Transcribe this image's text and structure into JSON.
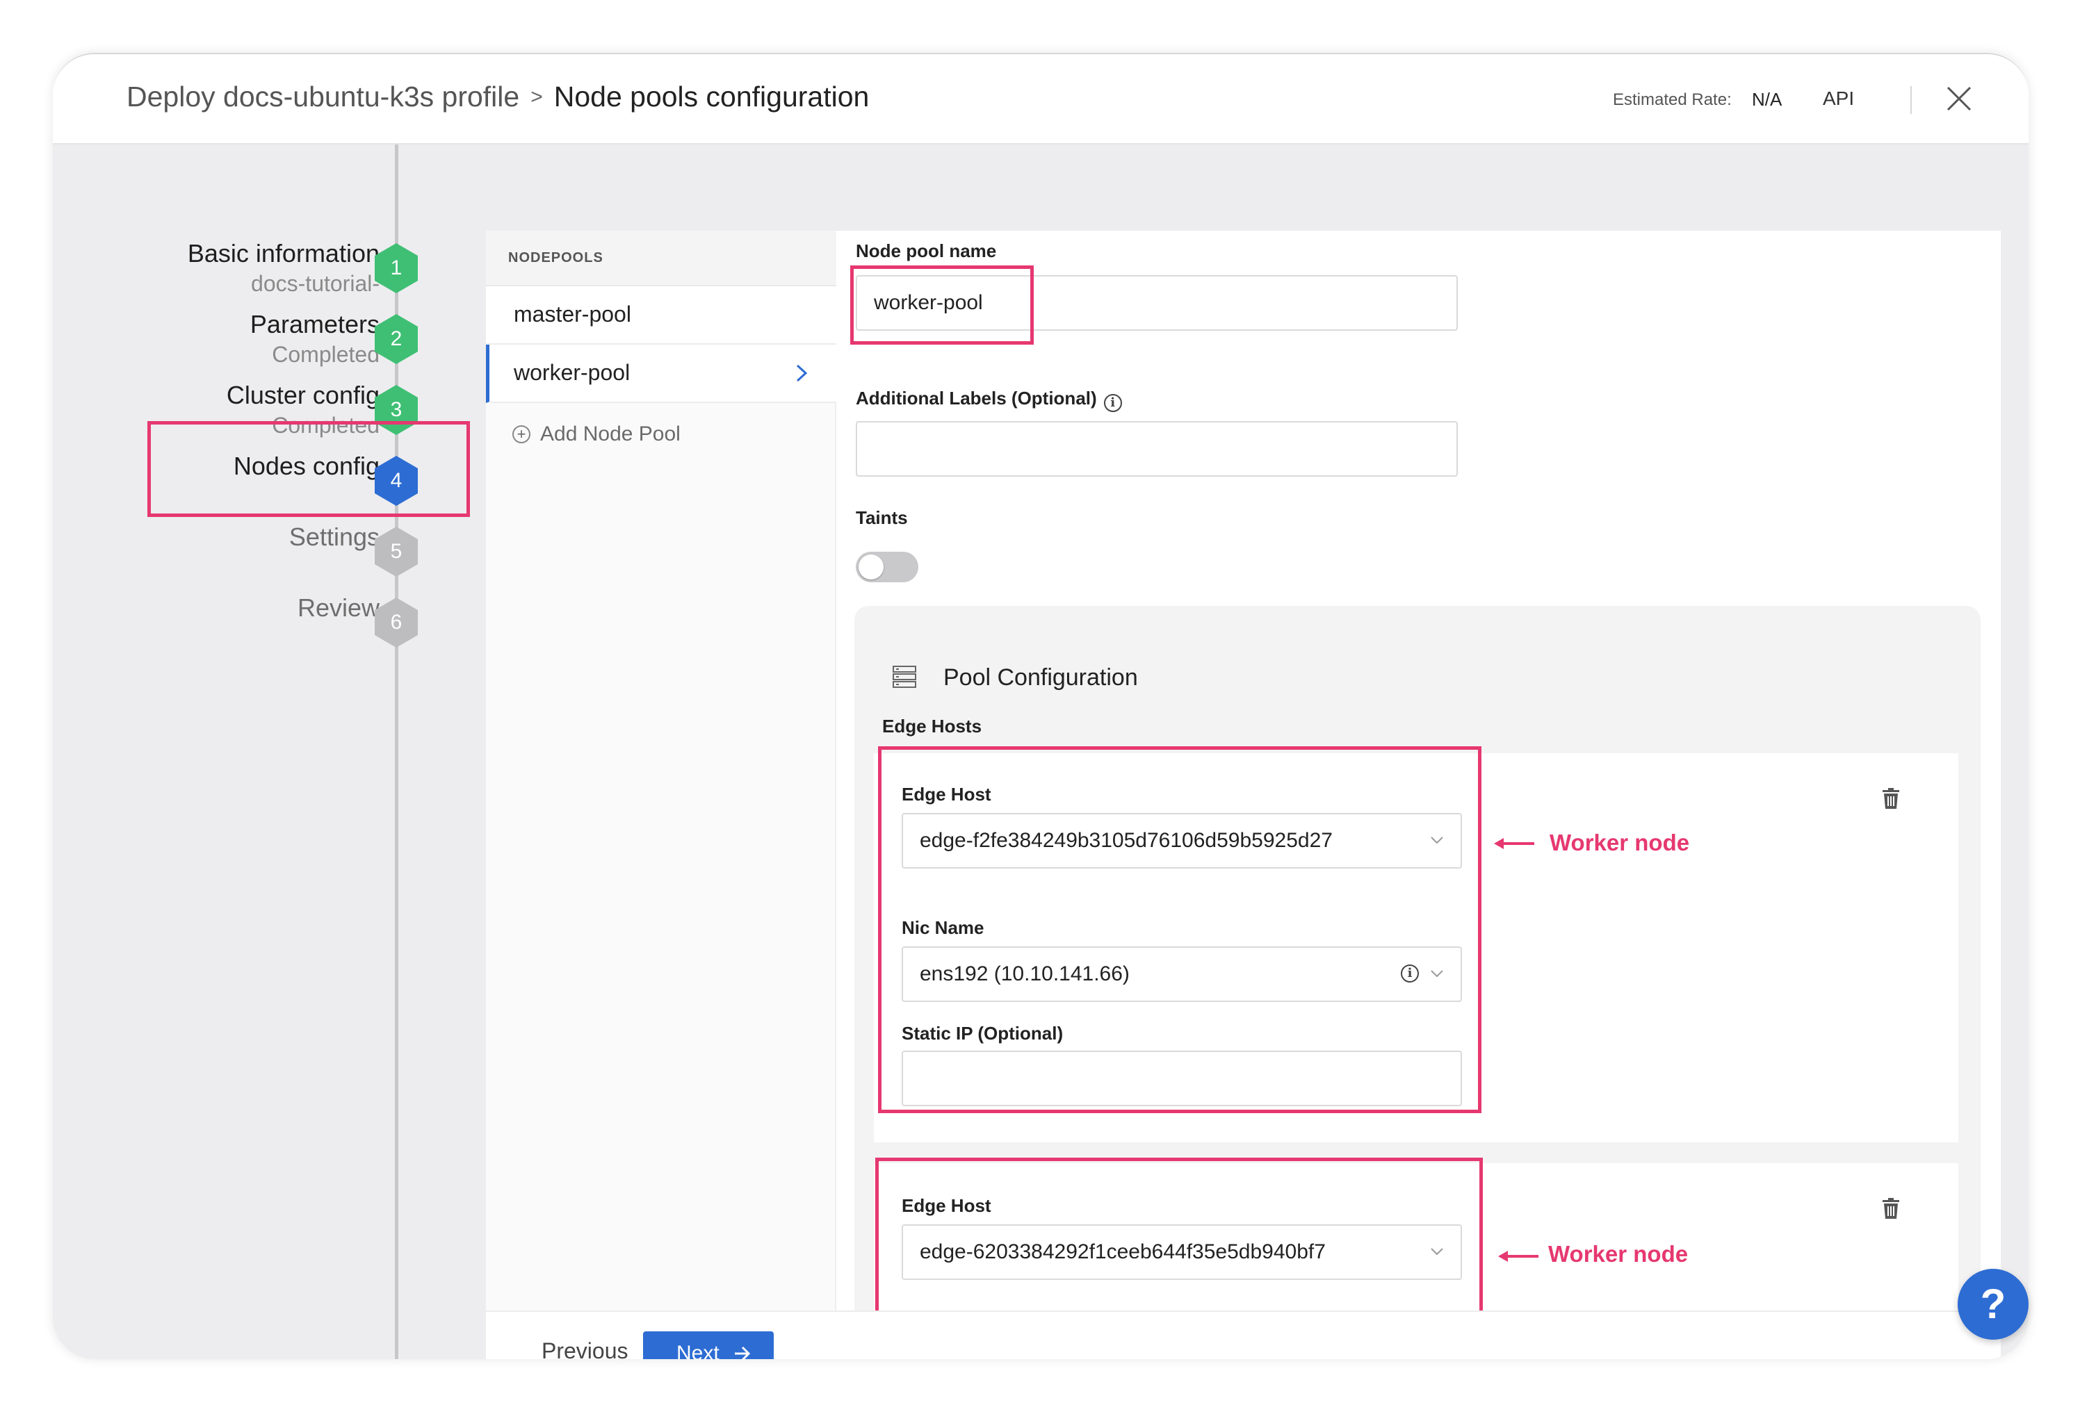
{
  "header": {
    "breadcrumb_parent": "Deploy docs-ubuntu-k3s profile",
    "breadcrumb_separator": ">",
    "breadcrumb_current": "Node pools configuration",
    "estimated_rate_label": "Estimated Rate:",
    "estimated_rate_value": "N/A",
    "api_label": "API",
    "close_icon": "close-icon"
  },
  "steps": [
    {
      "number": "1",
      "title": "Basic information",
      "subtitle": "docs-tutorial-",
      "state": "done"
    },
    {
      "number": "2",
      "title": "Parameters",
      "subtitle": "Completed",
      "state": "done"
    },
    {
      "number": "3",
      "title": "Cluster config",
      "subtitle": "Completed",
      "state": "done"
    },
    {
      "number": "4",
      "title": "Nodes config",
      "subtitle": "",
      "state": "active"
    },
    {
      "number": "5",
      "title": "Settings",
      "subtitle": "",
      "state": "todo"
    },
    {
      "number": "6",
      "title": "Review",
      "subtitle": "",
      "state": "todo"
    }
  ],
  "nodepools": {
    "heading": "NODEPOOLS",
    "items": [
      {
        "label": "master-pool",
        "selected": false
      },
      {
        "label": "worker-pool",
        "selected": true
      }
    ],
    "add_label": "Add Node Pool"
  },
  "form": {
    "pool_name_label": "Node pool name",
    "pool_name_value": "worker-pool",
    "labels_label": "Additional Labels (Optional)",
    "labels_value": "",
    "taints_label": "Taints",
    "taints_enabled": false
  },
  "pool_config": {
    "title": "Pool Configuration",
    "edge_hosts_label": "Edge Hosts",
    "hosts": [
      {
        "edge_host_label": "Edge Host",
        "edge_host_value": "edge-f2fe384249b3105d76106d59b5925d27",
        "nic_label": "Nic Name",
        "nic_value": "ens192 (10.10.141.66)",
        "static_ip_label": "Static IP (Optional)",
        "static_ip_value": "",
        "annotation": "Worker node"
      },
      {
        "edge_host_label": "Edge Host",
        "edge_host_value": "edge-6203384292f1ceeb644f35e5db940bf7",
        "annotation": "Worker node"
      }
    ]
  },
  "footer": {
    "previous_label": "Previous",
    "next_label": "Next"
  },
  "help_label": "?",
  "colors": {
    "accent": "#2d6cd3",
    "step_done": "#3fbf74",
    "step_todo": "#bdbdc0",
    "highlight": "#e63870"
  }
}
